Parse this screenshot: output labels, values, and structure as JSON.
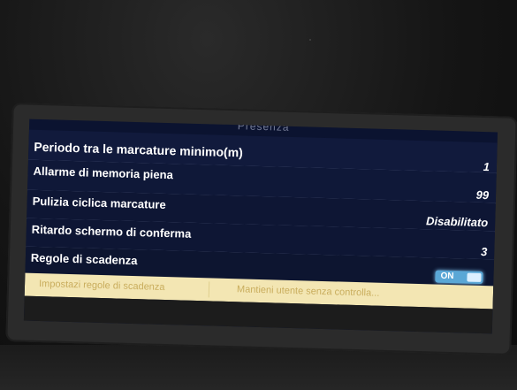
{
  "screen": {
    "header_title": "Presenza",
    "settings": [
      {
        "label": "Periodo tra le marcature minimo(m)",
        "value": "1"
      },
      {
        "label": "Allarme di memoria piena",
        "value": "99"
      },
      {
        "label": "Pulizia ciclica marcature",
        "value": "Disabilitato"
      },
      {
        "label": "Ritardo schermo di conferma",
        "value": "3"
      },
      {
        "label": "Regole di scadenza",
        "toggle_text": "ON"
      }
    ],
    "tabs": [
      {
        "label": "Impostazi regole di scadenza"
      },
      {
        "label": "Mantieni utente senza controlla..."
      }
    ]
  },
  "colors": {
    "screen_bg": "#0b1330",
    "toggle_on": "#5aa7d6",
    "tab_bg": "#f3e6b3",
    "tab_text": "#c9ad5d"
  }
}
